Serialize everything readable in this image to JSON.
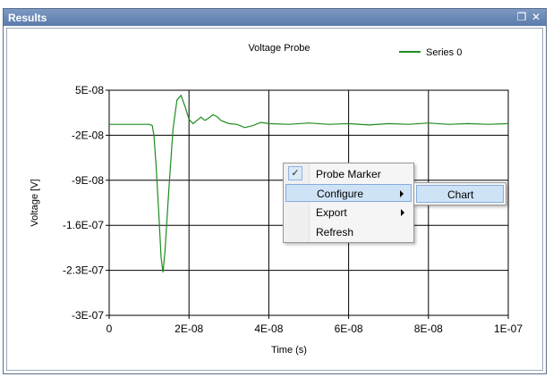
{
  "window": {
    "title": "Results",
    "restore_icon": "restore-icon",
    "close_icon": "close-icon",
    "restore_glyph": "❐",
    "close_glyph": "✕"
  },
  "chart_data": {
    "type": "line",
    "title": "Voltage Probe",
    "xlabel": "Time (s)",
    "ylabel": "Voltage [V]",
    "xlim": [
      0,
      1e-07
    ],
    "ylim": [
      -3e-07,
      5e-08
    ],
    "x_ticks": [
      "0",
      "2E-08",
      "4E-08",
      "6E-08",
      "8E-08",
      "1E-07"
    ],
    "y_ticks": [
      "5E-08",
      "-2E-08",
      "-9E-08",
      "-1.6E-07",
      "-2.3E-07",
      "-3E-07"
    ],
    "grid": true,
    "legend": "top-right",
    "series": [
      {
        "name": "Series 0",
        "color": "#1e8c1e",
        "x": [
          0,
          5e-09,
          1e-08,
          1.08e-08,
          1.12e-08,
          1.18e-08,
          1.25e-08,
          1.3e-08,
          1.35e-08,
          1.4e-08,
          1.5e-08,
          1.6e-08,
          1.7e-08,
          1.8e-08,
          1.9e-08,
          2e-08,
          2.1e-08,
          2.2e-08,
          2.3e-08,
          2.4e-08,
          2.5e-08,
          2.6e-08,
          2.7e-08,
          2.8e-08,
          3e-08,
          3.2e-08,
          3.4e-08,
          3.6e-08,
          3.8e-08,
          4e-08,
          4.5e-08,
          5e-08,
          5.5e-08,
          6e-08,
          6.5e-08,
          7e-08,
          7.5e-08,
          8e-08,
          8.5e-08,
          9e-08,
          9.5e-08,
          1e-07
        ],
        "y": [
          -3e-09,
          -3e-09,
          -3e-09,
          -5e-09,
          -2e-08,
          -7e-08,
          -1.5e-07,
          -2.1e-07,
          -2.33e-07,
          -2e-07,
          -1e-07,
          -1e-08,
          3.5e-08,
          4.2e-08,
          2.5e-08,
          5e-09,
          -2e-09,
          3e-09,
          8e-09,
          3e-09,
          7e-09,
          1.2e-08,
          9e-09,
          3e-09,
          -2e-09,
          -3e-09,
          -8e-09,
          -5e-09,
          0,
          -2e-09,
          -3e-09,
          -1e-09,
          -3e-09,
          -2e-09,
          -4e-09,
          -2e-09,
          -3e-09,
          -1e-09,
          -3e-09,
          -2e-09,
          -3e-09,
          -2e-09
        ]
      }
    ]
  },
  "context_menu": {
    "items": [
      {
        "label": "Probe Marker",
        "checked": true,
        "check_icon": "✓"
      },
      {
        "label": "Configure",
        "submenu": true
      },
      {
        "label": "Export",
        "submenu": true
      },
      {
        "label": "Refresh"
      }
    ],
    "submenu": {
      "items": [
        {
          "label": "Chart"
        }
      ]
    }
  }
}
